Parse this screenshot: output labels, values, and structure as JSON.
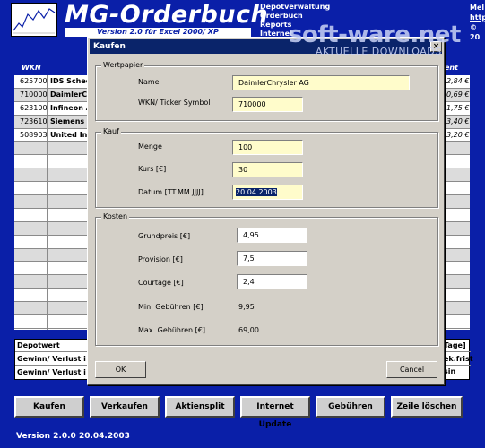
{
  "app": {
    "title": "MG-Orderbuch",
    "subtitle": "Version 2.0 für Excel 2000/ XP",
    "menu": [
      "Depotverwaltung",
      "Orderbuch",
      "Reports",
      "Internet"
    ],
    "right_lines": [
      "Mel",
      "http",
      "© 20"
    ]
  },
  "watermark": {
    "main": "soft-ware.net",
    "sub": "AKTUELLE DOWNLOADS"
  },
  "grid": {
    "col_wkn": "WKN",
    "col_right": "ent",
    "rows": [
      {
        "wkn": "625700",
        "name": "IDS Schee",
        "right": "2,84 €"
      },
      {
        "wkn": "710000",
        "name": "DaimlerC",
        "right": "0,69 €"
      },
      {
        "wkn": "623100",
        "name": "Infineon A",
        "right": "1,75 €"
      },
      {
        "wkn": "723610",
        "name": "Siemens",
        "right": "3,40 €"
      },
      {
        "wkn": "508903",
        "name": "United Int",
        "right": "3,20 €"
      }
    ]
  },
  "summary": {
    "rows": [
      {
        "label": "Depotwert",
        "right": "Tage]"
      },
      {
        "label": "Gewinn/ Verlust i",
        "right": "ek.frist sin"
      },
      {
        "label": "Gewinn/ Verlust i",
        "right": ""
      }
    ]
  },
  "buttons": [
    "Kaufen",
    "Verkaufen",
    "Aktiensplit",
    "Internet Update",
    "Gebühren",
    "Zeile löschen"
  ],
  "version": "Version 2.0.0 20.04.2003",
  "dialog": {
    "title": "Kaufen",
    "close": "×",
    "wertpapier": {
      "legend": "Wertpapier",
      "name_label": "Name",
      "name_value": "DaimlerChrysler AG",
      "wkn_label": "WKN/ Ticker Symbol",
      "wkn_value": "710000"
    },
    "kauf": {
      "legend": "Kauf",
      "menge_label": "Menge",
      "menge_value": "100",
      "kurs_label": "Kurs [€]",
      "kurs_value": "30",
      "datum_label": "Datum [TT.MM.JJJJ]",
      "datum_value": "20.04.2003"
    },
    "kosten": {
      "legend": "Kosten",
      "grundpreis_label": "Grundpreis [€]",
      "grundpreis_value": "4,95",
      "provision_label": "Provision [€]",
      "provision_value": "7,5",
      "courtage_label": "Courtage [€]",
      "courtage_value": "2,4",
      "min_label": "Min. Gebühren [€]",
      "min_value": "9,95",
      "max_label": "Max. Gebühren [€]",
      "max_value": "69,00"
    },
    "ok_label": "OK",
    "cancel_label": "Cancel"
  }
}
